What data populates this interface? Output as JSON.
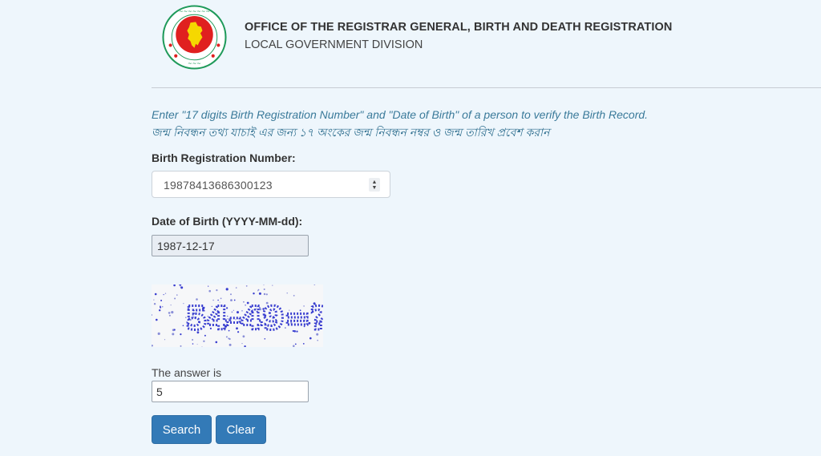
{
  "header": {
    "logo_icon": "government-seal-icon",
    "title": "OFFICE OF THE REGISTRAR GENERAL, BIRTH AND DEATH REGISTRATION",
    "subtitle": "LOCAL GOVERNMENT DIVISION"
  },
  "instructions": {
    "english": "Enter \"17 digits Birth Registration Number\" and \"Date of Birth\" of a person to verify the Birth Record.",
    "bengali": "জন্ম নিবন্ধন তথ্য যাচাই এর জন্য ১৭ অংকের জন্ম নিবন্ধন নম্বর ও জন্ম তারিখ প্রবেশ করান"
  },
  "form": {
    "brn_label": "Birth Registration Number:",
    "brn_value": "19878413686300123",
    "dob_label": "Date of Birth (YYYY-MM-dd):",
    "dob_value": "1987-12-17",
    "captcha_text": "54-49=?",
    "answer_label": "The answer is",
    "answer_value": "5"
  },
  "buttons": {
    "search": "Search",
    "clear": "Clear"
  },
  "colors": {
    "background": "#eef6fc",
    "primary_button": "#337ab7",
    "instruction_text": "#3a7a9a",
    "seal_green": "#1f9a5a",
    "seal_red": "#e0201f",
    "seal_yellow": "#f5d800",
    "captcha_blue": "#3a3fd0"
  }
}
